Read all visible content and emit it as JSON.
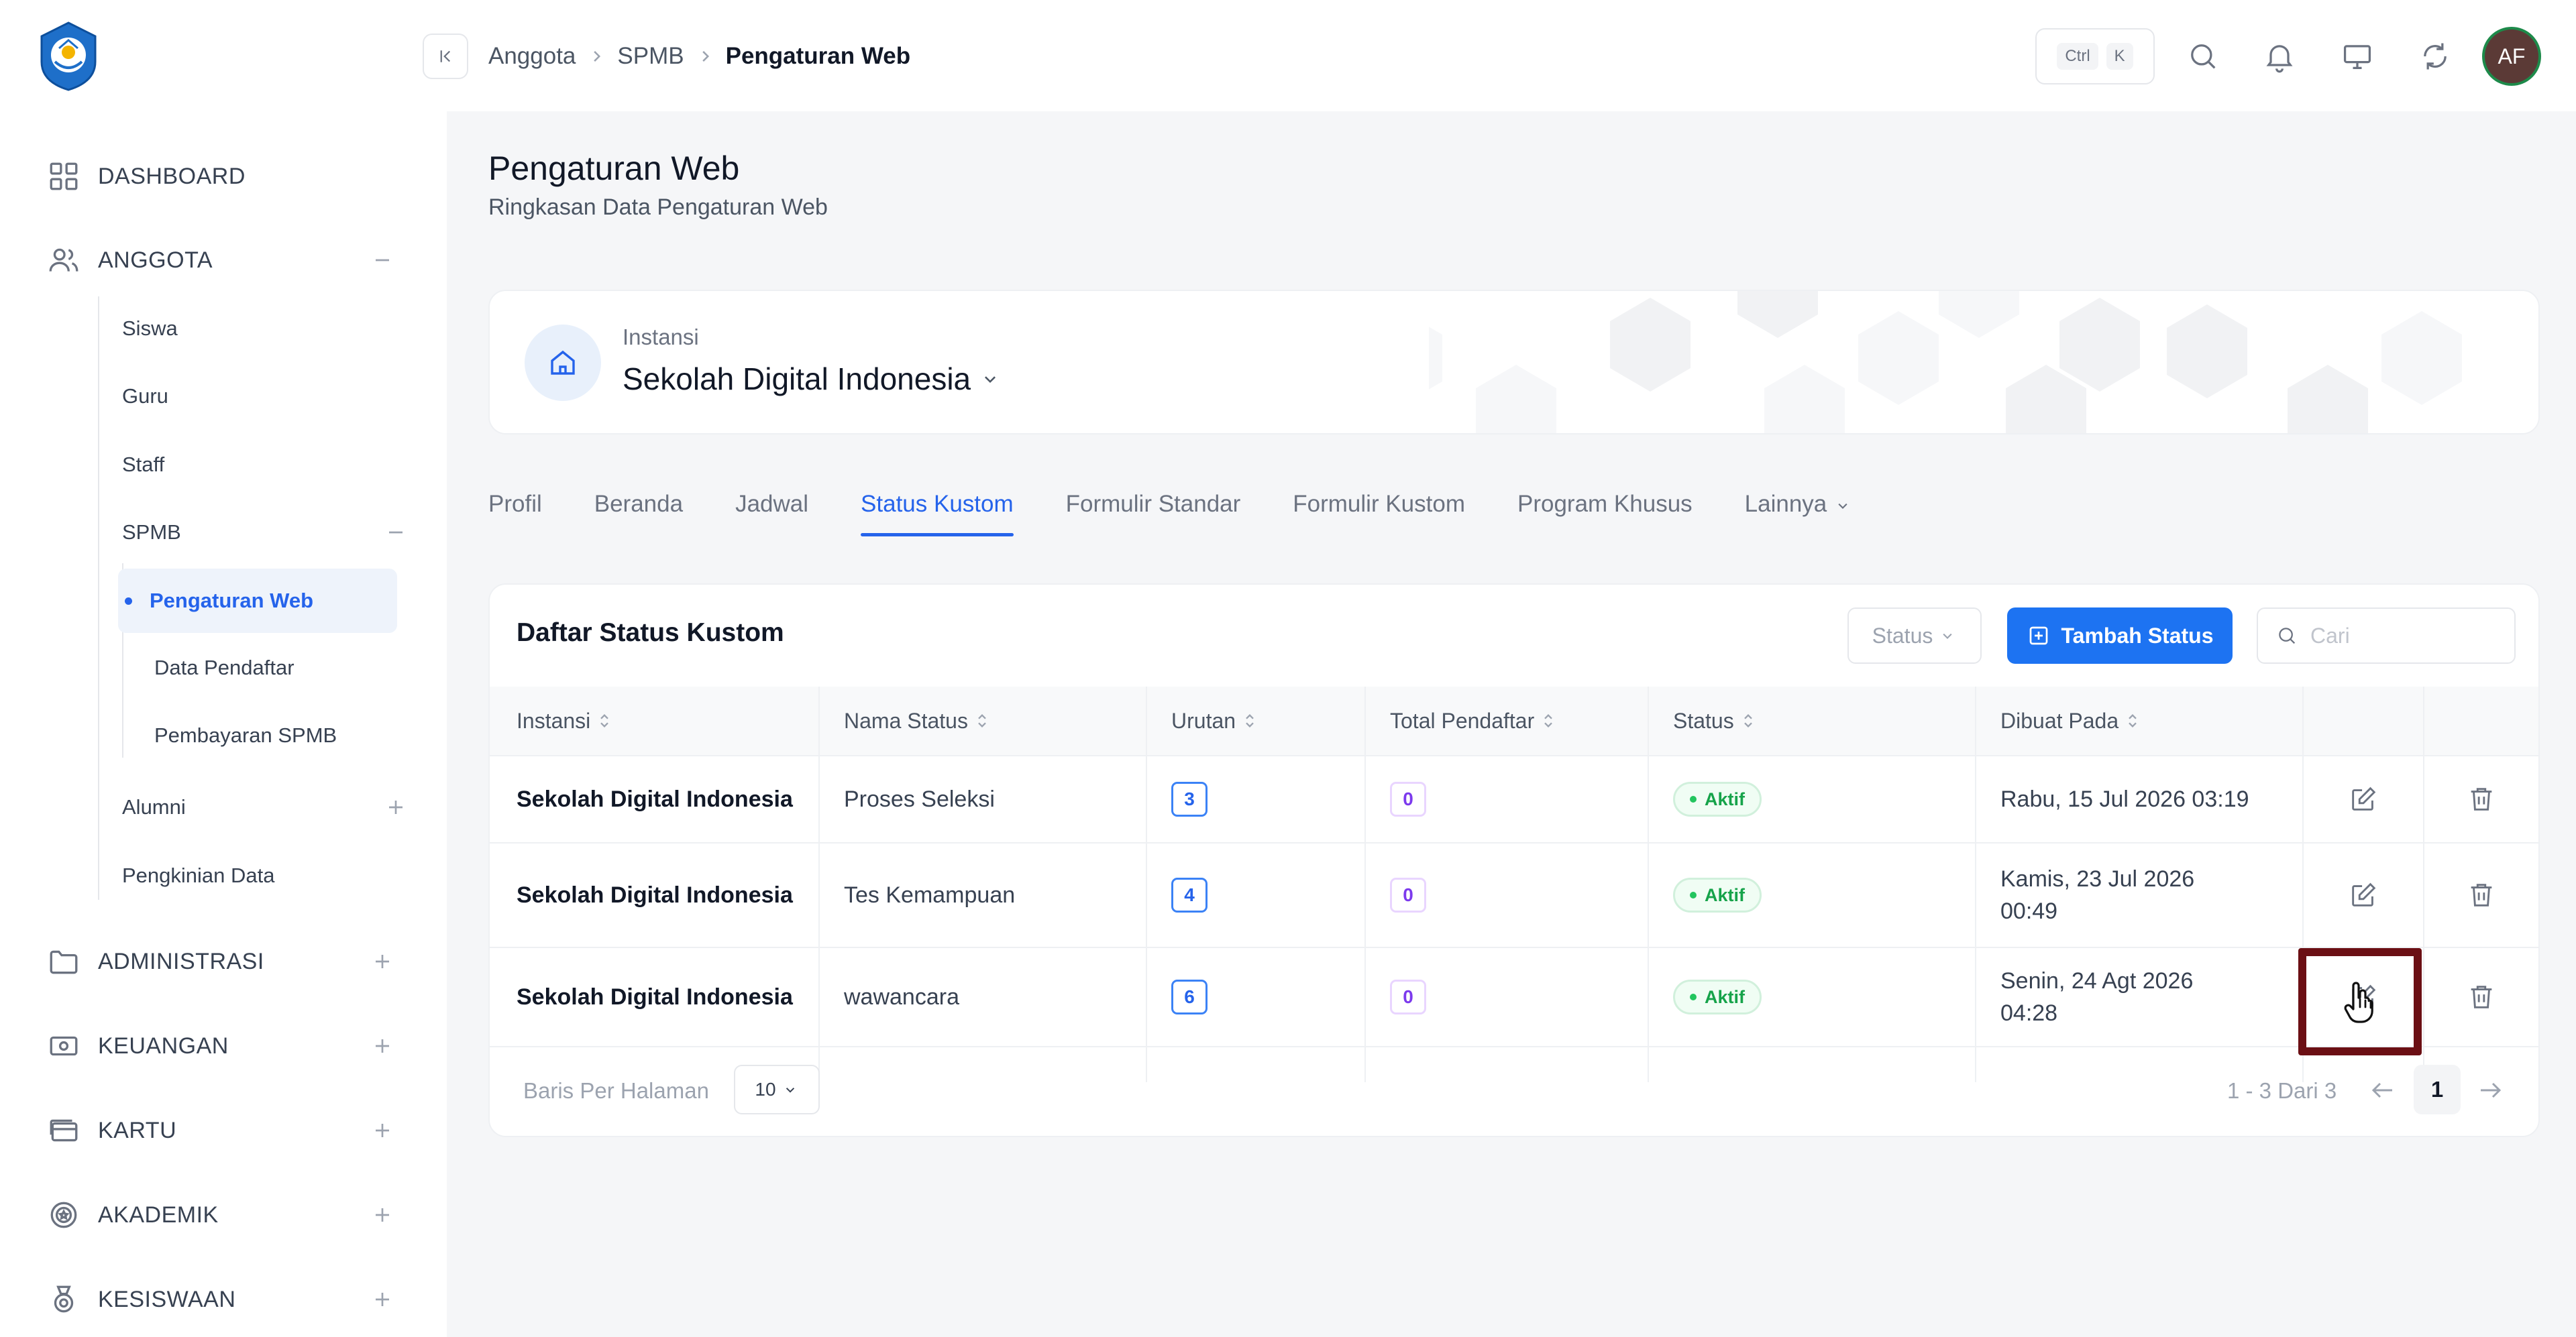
{
  "sidebar": {
    "top_items": [
      {
        "label": "DASHBOARD"
      },
      {
        "label": "ANGGOTA",
        "toggle": "minus"
      },
      {
        "label": "ADMINISTRASI",
        "toggle": "plus"
      },
      {
        "label": "KEUANGAN",
        "toggle": "plus"
      },
      {
        "label": "KARTU",
        "toggle": "plus"
      },
      {
        "label": "AKADEMIK",
        "toggle": "plus"
      },
      {
        "label": "KESISWAAN",
        "toggle": "plus"
      }
    ],
    "anggota_children": [
      "Siswa",
      "Guru",
      "Staff",
      "SPMB",
      "Alumni",
      "Pengkinian Data"
    ],
    "spmb_children": [
      "Pengaturan Web",
      "Data Pendaftar",
      "Pembayaran SPMB"
    ]
  },
  "topbar": {
    "breadcrumb": [
      "Anggota",
      "SPMB",
      "Pengaturan Web"
    ],
    "shortcut_keys": [
      "Ctrl",
      "K"
    ],
    "avatar_initials": "AF",
    "icons": [
      "search-icon",
      "bell-icon",
      "monitor-icon",
      "refresh-icon"
    ]
  },
  "page": {
    "title": "Pengaturan Web",
    "subtitle": "Ringkasan Data Pengaturan Web"
  },
  "instansi": {
    "label": "Instansi",
    "value": "Sekolah Digital Indonesia"
  },
  "tabs": [
    "Profil",
    "Beranda",
    "Jadwal",
    "Status Kustom",
    "Formulir Standar",
    "Formulir Kustom",
    "Program Khusus",
    "Lainnya"
  ],
  "active_tab": "Status Kustom",
  "table": {
    "title": "Daftar Status Kustom",
    "filter_label": "Status",
    "add_button": "Tambah Status",
    "search_placeholder": "Cari",
    "columns": [
      "Instansi",
      "Nama Status",
      "Urutan",
      "Total Pendaftar",
      "Status",
      "Dibuat Pada"
    ],
    "rows": [
      {
        "instansi": "Sekolah Digital Indonesia",
        "nama": "Proses Seleksi",
        "urutan": "3",
        "total": "0",
        "status": "Aktif",
        "dibuat_1": "Rabu, 15 Jul 2026 03:19",
        "dibuat_2": ""
      },
      {
        "instansi": "Sekolah Digital Indonesia",
        "nama": "Tes Kemampuan",
        "urutan": "4",
        "total": "0",
        "status": "Aktif",
        "dibuat_1": "Kamis, 23 Jul 2026",
        "dibuat_2": "00:49"
      },
      {
        "instansi": "Sekolah Digital Indonesia",
        "nama": "wawancara",
        "urutan": "6",
        "total": "0",
        "status": "Aktif",
        "dibuat_1": "Senin, 24 Agt 2026",
        "dibuat_2": "04:28"
      }
    ]
  },
  "pagination": {
    "per_page_label": "Baris Per Halaman",
    "per_page_value": "10",
    "info": "1 - 3 Dari 3",
    "current_page": "1"
  },
  "colors": {
    "primary": "#1d73f2",
    "active_text": "#2563eb",
    "status_green": "#16a34a",
    "highlight_box": "#6b0f14"
  }
}
